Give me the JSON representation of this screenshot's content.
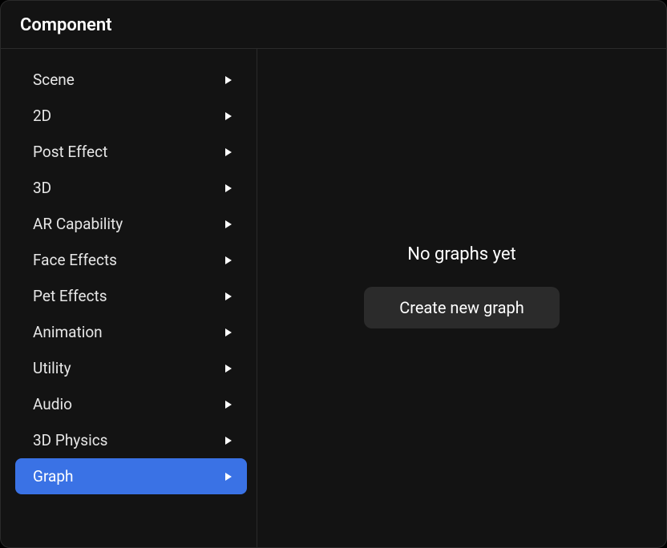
{
  "header": {
    "title": "Component"
  },
  "sidebar": {
    "items": [
      {
        "label": "Scene",
        "selected": false
      },
      {
        "label": "2D",
        "selected": false
      },
      {
        "label": "Post Effect",
        "selected": false
      },
      {
        "label": "3D",
        "selected": false
      },
      {
        "label": "AR Capability",
        "selected": false
      },
      {
        "label": "Face Effects",
        "selected": false
      },
      {
        "label": "Pet Effects",
        "selected": false
      },
      {
        "label": "Animation",
        "selected": false
      },
      {
        "label": "Utility",
        "selected": false
      },
      {
        "label": "Audio",
        "selected": false
      },
      {
        "label": "3D Physics",
        "selected": false
      },
      {
        "label": "Graph",
        "selected": true
      }
    ]
  },
  "main": {
    "empty_text": "No graphs yet",
    "create_button_label": "Create new graph"
  }
}
